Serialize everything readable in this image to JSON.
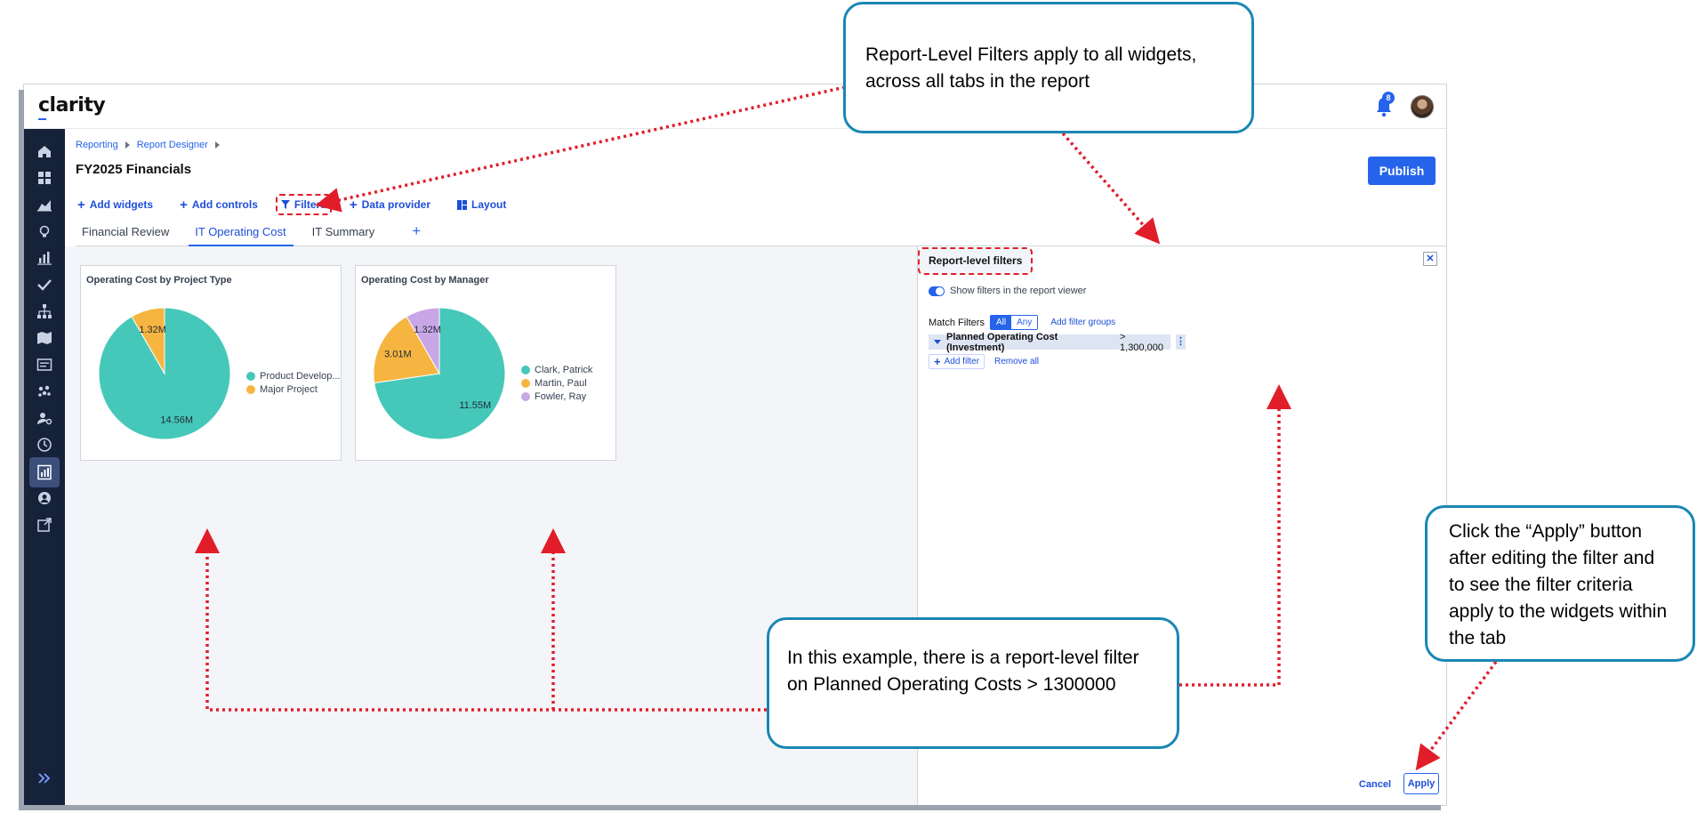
{
  "app": {
    "logo": "clarity",
    "notifications_count": "8",
    "bell_icon": "bell-icon",
    "avatar_icon": "avatar"
  },
  "breadcrumb": {
    "items": [
      "Reporting",
      "Report Designer"
    ]
  },
  "page": {
    "title": "FY2025 Financials",
    "publish_label": "Publish"
  },
  "toolbar": {
    "add_widgets": "Add widgets",
    "add_controls": "Add controls",
    "filters": "Filters",
    "data_provider": "Data provider",
    "layout": "Layout"
  },
  "tabs": {
    "items": [
      "Financial Review",
      "IT Operating Cost",
      "IT Summary"
    ],
    "active": "IT Operating Cost",
    "add": "+"
  },
  "sidebar": {
    "icons": [
      "home-icon",
      "dashboard-icon",
      "area-chart-icon",
      "lightbulb-icon",
      "bar-chart-icon",
      "checkmark-icon",
      "hierarchy-icon",
      "map-icon",
      "form-icon",
      "team-icon",
      "user-settings-icon",
      "clock-icon",
      "report-icon",
      "support-icon",
      "external-link-icon"
    ],
    "active_icon": "report-icon",
    "expand_icon": "double-chevron-right-icon"
  },
  "colors": {
    "accent": "#2563eb",
    "sidebar": "#16213a",
    "teal": "#45c8b9",
    "orange": "#f6b540",
    "lilac": "#c9a7e6",
    "callout_border": "#1a86b5",
    "annotation_red": "#e11d2a"
  },
  "widgets": [
    {
      "title": "Operating Cost by Project Type",
      "data_labels": [
        "1.32M",
        "14.56M"
      ],
      "legend": [
        "Product Develop...",
        "Major Project"
      ]
    },
    {
      "title": "Operating Cost by Manager",
      "data_labels": [
        "1.32M",
        "3.01M",
        "11.55M"
      ],
      "legend": [
        "Clark, Patrick",
        "Martin, Paul",
        "Fowler, Ray"
      ]
    }
  ],
  "chart_data": [
    {
      "type": "pie",
      "title": "Operating Cost by Project Type",
      "categories": [
        "Product Develop...",
        "Major Project"
      ],
      "values": [
        14.56,
        1.32
      ],
      "value_labels": [
        "14.56M",
        "1.32M"
      ],
      "colors": [
        "#45c8b9",
        "#f6b540"
      ],
      "legend_placement": "right"
    },
    {
      "type": "pie",
      "title": "Operating Cost by Manager",
      "categories": [
        "Clark, Patrick",
        "Martin, Paul",
        "Fowler, Ray"
      ],
      "values": [
        11.55,
        3.01,
        1.32
      ],
      "value_labels": [
        "11.55M",
        "3.01M",
        "1.32M"
      ],
      "colors": [
        "#45c8b9",
        "#f6b540",
        "#c9a7e6"
      ],
      "legend_placement": "right"
    }
  ],
  "panel": {
    "title": "Report-level filters",
    "close_icon": "close-icon",
    "toggle_label": "Show filters in the report viewer",
    "toggle_on": true,
    "match_label": "Match Filters",
    "match_all": "All",
    "match_any": "Any",
    "add_filter_groups": "Add filter groups",
    "filter_field": "Planned Operating Cost (Investment)",
    "filter_condition": "> 1,300,000",
    "add_filter": "Add filter",
    "remove_all": "Remove all",
    "cancel": "Cancel",
    "apply": "Apply"
  },
  "callouts": {
    "top": "Report-Level Filters apply to all widgets, across all tabs in the report",
    "bottom": "In this example, there is a report-level filter on Planned Operating Costs > 1300000",
    "right": "Click the “Apply” button after editing the filter and to see the filter criteria apply to the widgets within the tab"
  }
}
